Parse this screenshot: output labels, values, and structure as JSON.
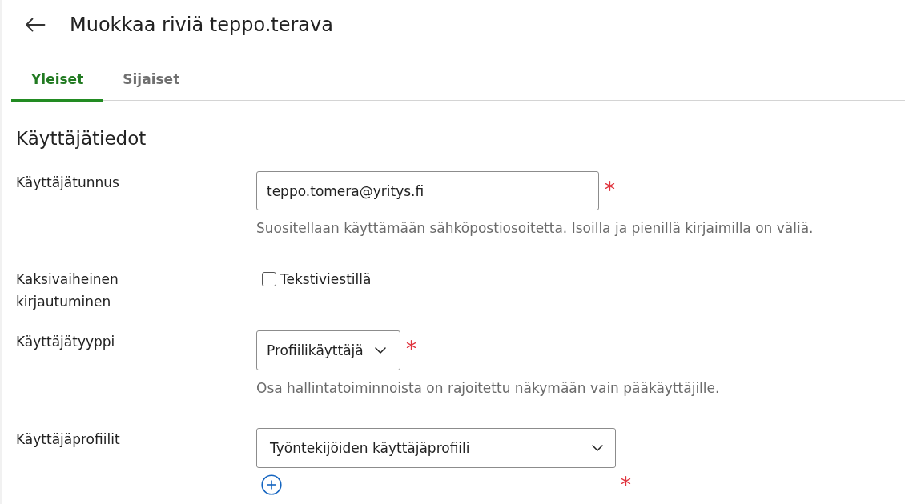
{
  "header": {
    "title": "Muokkaa riviä teppo.terava"
  },
  "tabs": [
    {
      "label": "Yleiset",
      "selected": true
    },
    {
      "label": "Sijaiset",
      "selected": false
    }
  ],
  "section": {
    "title": "Käyttäjätiedot",
    "fields": [
      {
        "kind": "text",
        "label": "Käyttäjätunnus",
        "value": "teppo.tomera@yritys.fi",
        "required": true,
        "hint": "Suositellaan käyttämään sähköpostiosoitetta. Isoilla ja pienillä kirjaimilla on väliä."
      },
      {
        "kind": "checkbox",
        "label": "Kaksivaiheinen kirjautuminen",
        "option": "Tekstiviestillä",
        "checked": false
      },
      {
        "kind": "select",
        "label": "Käyttäjätyyppi",
        "value": "Profiilikäyttäjä",
        "required": true,
        "hint": "Osa hallintatoiminnoista on rajoitettu näkymään vain pääkäyttäjille."
      },
      {
        "kind": "multiselect",
        "label": "Käyttäjäprofiilit",
        "value": "Työntekijöiden käyttäjäprofiili",
        "required": true
      }
    ]
  }
}
